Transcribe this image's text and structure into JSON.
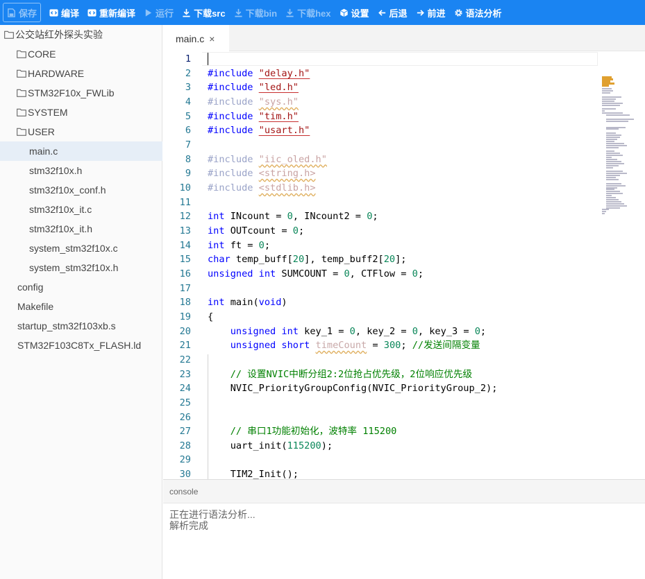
{
  "toolbar": {
    "save": "保存",
    "compile": "编译",
    "recompile": "重新编译",
    "run": "运行",
    "download_src": "下载src",
    "download_bin": "下载bin",
    "download_hex": "下载hex",
    "settings": "设置",
    "back": "后退",
    "forward": "前进",
    "syntax": "语法分析"
  },
  "sidebar": {
    "project": "公交站红外探头实验",
    "items": [
      {
        "label": "CORE",
        "type": "folder"
      },
      {
        "label": "HARDWARE",
        "type": "folder"
      },
      {
        "label": "STM32F10x_FWLib",
        "type": "folder"
      },
      {
        "label": "SYSTEM",
        "type": "folder"
      },
      {
        "label": "USER",
        "type": "folder"
      },
      {
        "label": "main.c",
        "type": "file"
      },
      {
        "label": "stm32f10x.h",
        "type": "file"
      },
      {
        "label": "stm32f10x_conf.h",
        "type": "file"
      },
      {
        "label": "stm32f10x_it.c",
        "type": "file"
      },
      {
        "label": "stm32f10x_it.h",
        "type": "file"
      },
      {
        "label": "system_stm32f10x.c",
        "type": "file"
      },
      {
        "label": "system_stm32f10x.h",
        "type": "file"
      },
      {
        "label": "config",
        "type": "root-file"
      },
      {
        "label": "Makefile",
        "type": "root-file"
      },
      {
        "label": "startup_stm32f103xb.s",
        "type": "root-file"
      },
      {
        "label": "STM32F103C8Tx_FLASH.ld",
        "type": "root-file"
      }
    ]
  },
  "editor": {
    "tab_label": "main.c",
    "tab_close": "×",
    "lines": [
      {
        "n": "1",
        "t": []
      },
      {
        "n": "2",
        "t": [
          [
            "kw",
            "#include"
          ],
          [
            "",
            " "
          ],
          [
            "str",
            "\"delay.h\""
          ]
        ]
      },
      {
        "n": "3",
        "t": [
          [
            "kw",
            "#include"
          ],
          [
            "",
            " "
          ],
          [
            "str",
            "\"led.h\""
          ]
        ]
      },
      {
        "n": "4",
        "t": [
          [
            "kwd",
            "#include"
          ],
          [
            "",
            " "
          ],
          [
            "strd",
            "\"sys.h\""
          ]
        ]
      },
      {
        "n": "5",
        "t": [
          [
            "kw",
            "#include"
          ],
          [
            "",
            " "
          ],
          [
            "str",
            "\"tim.h\""
          ]
        ]
      },
      {
        "n": "6",
        "t": [
          [
            "kw",
            "#include"
          ],
          [
            "",
            " "
          ],
          [
            "str",
            "\"usart.h\""
          ]
        ]
      },
      {
        "n": "7",
        "t": []
      },
      {
        "n": "8",
        "t": [
          [
            "kwd",
            "#include"
          ],
          [
            "",
            " "
          ],
          [
            "strd",
            "\"iic_oled.h\""
          ]
        ]
      },
      {
        "n": "9",
        "t": [
          [
            "kwd",
            "#include"
          ],
          [
            "",
            " "
          ],
          [
            "strd",
            "<string.h>"
          ]
        ]
      },
      {
        "n": "10",
        "t": [
          [
            "kwd",
            "#include"
          ],
          [
            "",
            " "
          ],
          [
            "strd",
            "<stdlib.h>"
          ]
        ]
      },
      {
        "n": "11",
        "t": []
      },
      {
        "n": "12",
        "t": [
          [
            "kw",
            "int"
          ],
          [
            "",
            " INcount = "
          ],
          [
            "num",
            "0"
          ],
          [
            "",
            ", INcount2 = "
          ],
          [
            "num",
            "0"
          ],
          [
            "",
            ";"
          ]
        ]
      },
      {
        "n": "13",
        "t": [
          [
            "kw",
            "int"
          ],
          [
            "",
            " OUTcount = "
          ],
          [
            "num",
            "0"
          ],
          [
            "",
            ";"
          ]
        ]
      },
      {
        "n": "14",
        "t": [
          [
            "kw",
            "int"
          ],
          [
            "",
            " ft = "
          ],
          [
            "num",
            "0"
          ],
          [
            "",
            ";"
          ]
        ]
      },
      {
        "n": "15",
        "t": [
          [
            "kw",
            "char"
          ],
          [
            "",
            " temp_buff["
          ],
          [
            "num",
            "20"
          ],
          [
            "",
            "], temp_buff2["
          ],
          [
            "num",
            "20"
          ],
          [
            "",
            "];"
          ]
        ]
      },
      {
        "n": "16",
        "t": [
          [
            "kw",
            "unsigned"
          ],
          [
            "",
            " "
          ],
          [
            "kw",
            "int"
          ],
          [
            "",
            " SUMCOUNT = "
          ],
          [
            "num",
            "0"
          ],
          [
            "",
            ", CTFlow = "
          ],
          [
            "num",
            "0"
          ],
          [
            "",
            ";"
          ]
        ]
      },
      {
        "n": "17",
        "t": []
      },
      {
        "n": "18",
        "t": [
          [
            "kw",
            "int"
          ],
          [
            "",
            " main("
          ],
          [
            "kw",
            "void"
          ],
          [
            "",
            ")"
          ]
        ]
      },
      {
        "n": "19",
        "t": [
          [
            "",
            "{"
          ]
        ]
      },
      {
        "n": "20",
        "t": [
          [
            "",
            "    "
          ],
          [
            "kw",
            "unsigned"
          ],
          [
            "",
            " "
          ],
          [
            "kw",
            "int"
          ],
          [
            "",
            " key_1 = "
          ],
          [
            "num",
            "0"
          ],
          [
            "",
            ", key_2 = "
          ],
          [
            "num",
            "0"
          ],
          [
            "",
            ", key_3 = "
          ],
          [
            "num",
            "0"
          ],
          [
            "",
            ";"
          ]
        ]
      },
      {
        "n": "21",
        "t": [
          [
            "",
            "    "
          ],
          [
            "kw",
            "unsigned"
          ],
          [
            "",
            " "
          ],
          [
            "kw",
            "short"
          ],
          [
            "",
            " "
          ],
          [
            "warn",
            "timeCount"
          ],
          [
            "",
            " = "
          ],
          [
            "num",
            "300"
          ],
          [
            "",
            "; "
          ],
          [
            "cmt",
            "//发送间隔变量"
          ]
        ]
      },
      {
        "n": "22",
        "t": []
      },
      {
        "n": "23",
        "t": [
          [
            "",
            "    "
          ],
          [
            "cmt",
            "// 设置NVIC中断分组2:2位抢占优先级，2位响应优先级"
          ]
        ]
      },
      {
        "n": "24",
        "t": [
          [
            "",
            "    NVIC_PriorityGroupConfig(NVIC_PriorityGroup_2);"
          ]
        ]
      },
      {
        "n": "25",
        "t": []
      },
      {
        "n": "26",
        "t": []
      },
      {
        "n": "27",
        "t": [
          [
            "",
            "    "
          ],
          [
            "cmt",
            "// 串口1功能初始化，波特率 115200"
          ]
        ]
      },
      {
        "n": "28",
        "t": [
          [
            "",
            "    uart_init("
          ],
          [
            "num",
            "115200"
          ],
          [
            "",
            ");"
          ]
        ]
      },
      {
        "n": "29",
        "t": []
      },
      {
        "n": "30",
        "t": [
          [
            "",
            "    TIM2_Init();"
          ]
        ]
      }
    ]
  },
  "console": {
    "title": "console",
    "lines": [
      "正在进行语法分析...",
      "解析完成"
    ]
  },
  "colors": {
    "toolbar_bg": "#1a84f2",
    "keyword": "#0000ff",
    "string": "#a31515",
    "number": "#098658",
    "comment": "#008000",
    "line_number": "#237893"
  }
}
